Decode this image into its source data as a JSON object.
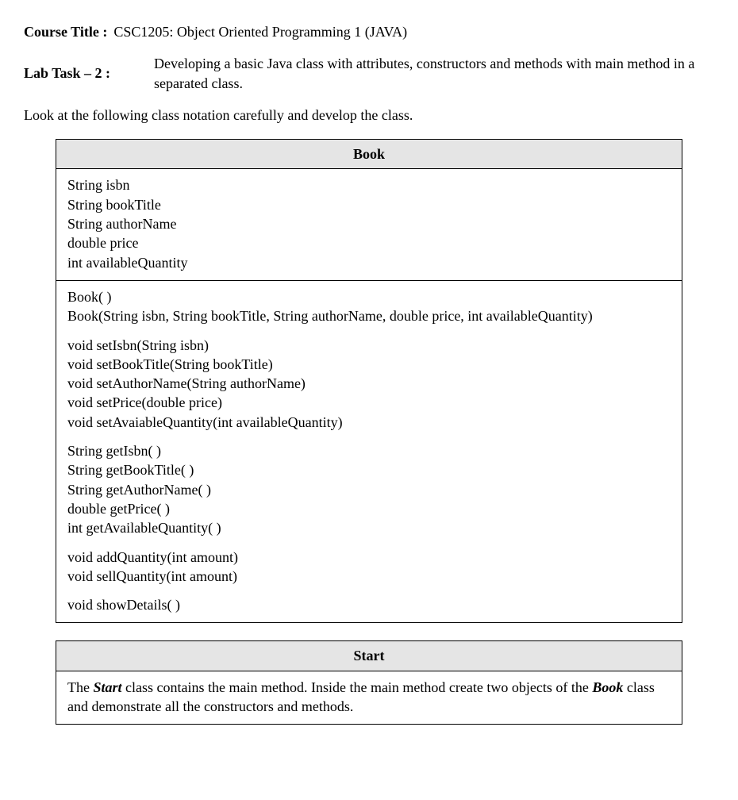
{
  "header": {
    "courseTitleLabel": "Course Title :",
    "courseTitleValue": "CSC1205: Object Oriented Programming 1 (JAVA)",
    "labTaskLabel": "Lab Task – 2 :",
    "labTaskDesc": "Developing a basic Java class with attributes, constructors and methods with main method in a separated class.",
    "instruction": "Look at the following class notation carefully and develop the class."
  },
  "bookTable": {
    "title": "Book",
    "attributes": [
      "String isbn",
      "String bookTitle",
      "String authorName",
      "double price",
      "int availableQuantity"
    ],
    "constructors": [
      "Book( )",
      "Book(String isbn, String bookTitle, String authorName, double price, int availableQuantity)"
    ],
    "setters": [
      "void setIsbn(String isbn)",
      "void setBookTitle(String bookTitle)",
      "void setAuthorName(String authorName)",
      "void setPrice(double price)",
      "void setAvaiableQuantity(int availableQuantity)"
    ],
    "getters": [
      "String getIsbn( )",
      "String getBookTitle( )",
      "String getAuthorName( )",
      "double getPrice( )",
      "int getAvailableQuantity( )"
    ],
    "operations": [
      "void addQuantity(int amount)",
      "void sellQuantity(int amount)"
    ],
    "display": [
      "void showDetails( )"
    ]
  },
  "startTable": {
    "title": "Start",
    "body": {
      "prefix": "The ",
      "b1": "Start",
      "mid1": " class contains the main method. Inside the main method create two objects of the ",
      "b2": "Book",
      "suffix": " class and demonstrate all the constructors and methods."
    }
  }
}
